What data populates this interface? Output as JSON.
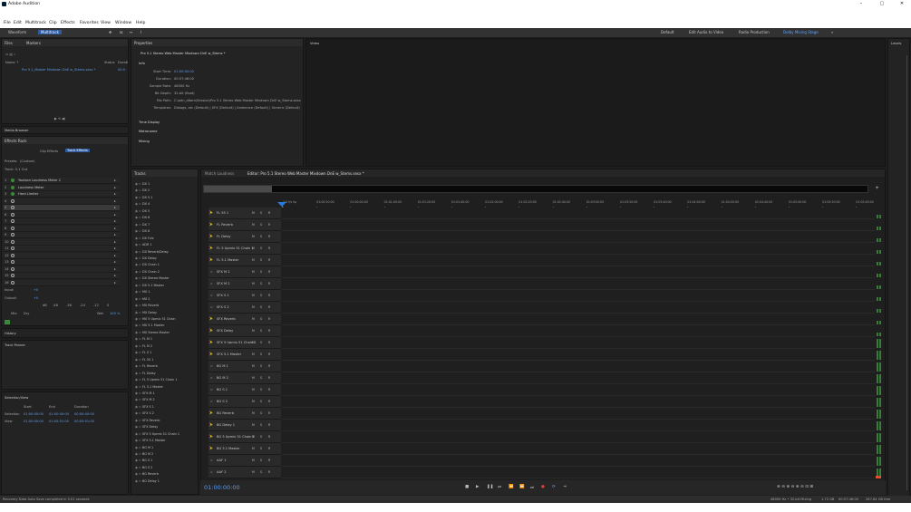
{
  "window": {
    "title": "Adobe Audition"
  },
  "menu": [
    "File",
    "Edit",
    "Multitrack",
    "Clip",
    "Effects",
    "Favorites",
    "View",
    "Window",
    "Help"
  ],
  "toolbar": {
    "waveform": "Waveform",
    "multitrack": "Multitrack",
    "workspaces": [
      "Default",
      "Edit Audio to Video",
      "Radio Production",
      "Dolby Mixing Stage"
    ],
    "active_workspace": "Dolby Mixing Stage"
  },
  "files": {
    "tab": "Files",
    "tab2": "Markers",
    "col_name": "Name ↑",
    "col_status": "Status",
    "col_duration": "Durati",
    "item": "Pro 5.1_Master Mixdown DnE w_Stems.sesx *",
    "item_dur": "00:5"
  },
  "media_browser": "Media Browser",
  "effects_rack": {
    "title": "Effects Rack",
    "tab_clip": "Clip Effects",
    "tab_track": "Track Effects",
    "presets_label": "Presets:",
    "presets_value": "(Custom)",
    "track_label": "Track: 5.1 Out",
    "slots": [
      "1",
      "2",
      "3",
      "4",
      "5",
      "6",
      "7",
      "8",
      "9",
      "10",
      "11",
      "12",
      "13",
      "14",
      "15",
      "16"
    ],
    "effects": [
      "Youlean Loudness Meter 2",
      "Loudness Meter",
      "Hard Limiter"
    ],
    "input": "Input:",
    "output": "Output:",
    "db": "+0",
    "scale": [
      "dB",
      "-48",
      "-36",
      "-24",
      "-12",
      "0"
    ],
    "mix": "Mix:",
    "dry": "Dry",
    "wet": "Wet",
    "pct": "100 %"
  },
  "history": "History",
  "track_panner": "Track Panner",
  "selection": {
    "title": "Selection/View",
    "cols": [
      "Start",
      "End",
      "Duration"
    ],
    "sel_label": "Selection",
    "sel": [
      "01:00:00:00",
      "01:00:00:00",
      "00:00:00:00"
    ],
    "view_label": "View",
    "view": [
      "01:00:00:00",
      "01:05:51:05",
      "00:05:51:05"
    ]
  },
  "properties": {
    "title": "Properties",
    "file": "Pro 5.1 Stereo Web Master Mixdown DnE w_Stems *",
    "info": "Info",
    "rows": [
      {
        "k": "Start Time:",
        "v": "01:00:00:00"
      },
      {
        "k": "Duration:",
        "v": "00:57:46:00"
      },
      {
        "k": "Sample Rate:",
        "v": "48000 Hz"
      },
      {
        "k": "Bit Depth:",
        "v": "32-bit (float)"
      },
      {
        "k": "File Path:",
        "v": "C:\\adn_dltam\\Session\\Pro 5.1 Stereo Web Master Mixdown DnE w_Stems.sesx"
      },
      {
        "k": "Templates:",
        "v": "Dialogs, etc (Default) | SFX (Default) | Ambience (Default) | Generic (Default)"
      }
    ],
    "sections": [
      "Time Display",
      "Metronome",
      "Mixing"
    ]
  },
  "video": "Video",
  "levels": "Levels",
  "tracks_panel": {
    "title": "Tracks",
    "items": [
      "DX 1",
      "DX 2",
      "DX 5.1",
      "DX 4",
      "DX 5",
      "DX 6",
      "DX 7",
      "DX 8",
      "DX Fxlz",
      "ADR 1",
      "DX Reverb/Delay",
      "DX Delay",
      "DX Chain 1",
      "DX Chain 2",
      "DX Stereo Master",
      "DX 5.1 Master",
      "MX 1",
      "MX 2",
      "MX Reverb",
      "MX Delay",
      "MX 5 Upmix 51 Chain",
      "MX 5.1 Master",
      "MX Stereo Master",
      "FL M 1",
      "FL M 2",
      "FL S 1",
      "FL 5S 1",
      "FL Reverb",
      "FL Delay",
      "FL 5 Upmix 51 Chain 1",
      "FL 5.1 Master",
      "SFX M 1",
      "SFX M 2",
      "SFX S 1",
      "SFX S 2",
      "SFX Reverb",
      "SFX Delay",
      "SFX 5 Upmix 51 Chain 1",
      "SFX 5.1 Master",
      "BG M 1",
      "BG M 2",
      "BG S 1",
      "BG S 2",
      "BG Reverb",
      "BG Delay 1"
    ]
  },
  "editor": {
    "tab1": "Match Loudness",
    "tab2": "Editor: Pro 5.1 Stereo Web Master Mixdown DnE w_Stems.sesx *",
    "ruler": [
      "1:0 f/s hp",
      "01:00:20:00",
      "01:00:40:00",
      "01:01:00:00",
      "01:01:20:00",
      "01:01:40:00",
      "01:02:00:00",
      "01:02:20:00",
      "01:02:40:00",
      "01:03:00:00",
      "01:03:20:00",
      "01:03:40:00",
      "01:04:00:00",
      "01:04:20:00",
      "01:04:40:00",
      "01:05:00:00",
      "01:05:20:00",
      "01:05:40:00"
    ],
    "tracks": [
      "FL 55 1",
      "FL Reverb",
      "FL Delay",
      "FL 5 Upmix 51 Chain 1",
      "FL 5.1 Master",
      "SFX M 1",
      "SFX M 2",
      "SFX S 1",
      "SFX S 2",
      "SFX Reverb",
      "SFX Delay",
      "SFX 5 Upmix 51 Chain 1",
      "SFX 5.1 Master",
      "BG M 1",
      "BG M 2",
      "BG S 1",
      "BG S 2",
      "BG Reverb",
      "BG Delay 1",
      "BG 5 Upmix 51 Chain 1",
      "BG 5.1 Master",
      "AAF 1",
      "AAF 2"
    ],
    "timecode": "01:00:00:00"
  },
  "status": {
    "left": "Recovery Data Auto Save completed in 0.01 seconds",
    "right": [
      "48000 Hz • 32-bit Mixing",
      "1.72 GB",
      "00:57:46:00",
      "267.84 GB free"
    ]
  },
  "colors": {
    "accent": "#2d5aa0",
    "timecode": "#5e9bea",
    "playhead": "#e04040",
    "record": "#e83c3c"
  }
}
